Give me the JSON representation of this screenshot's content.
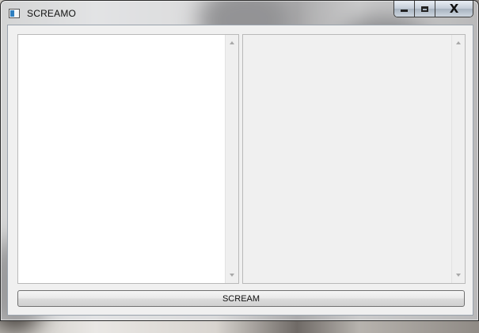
{
  "window": {
    "title": "SCREAMO",
    "icon": "app-window-icon"
  },
  "caption_buttons": {
    "minimize_icon": "minimize-icon",
    "maximize_icon": "maximize-icon",
    "close_glyph": "X"
  },
  "panes": {
    "left": {
      "text": ""
    },
    "right": {
      "text": ""
    }
  },
  "action": {
    "scream_label": "SCREAM"
  }
}
